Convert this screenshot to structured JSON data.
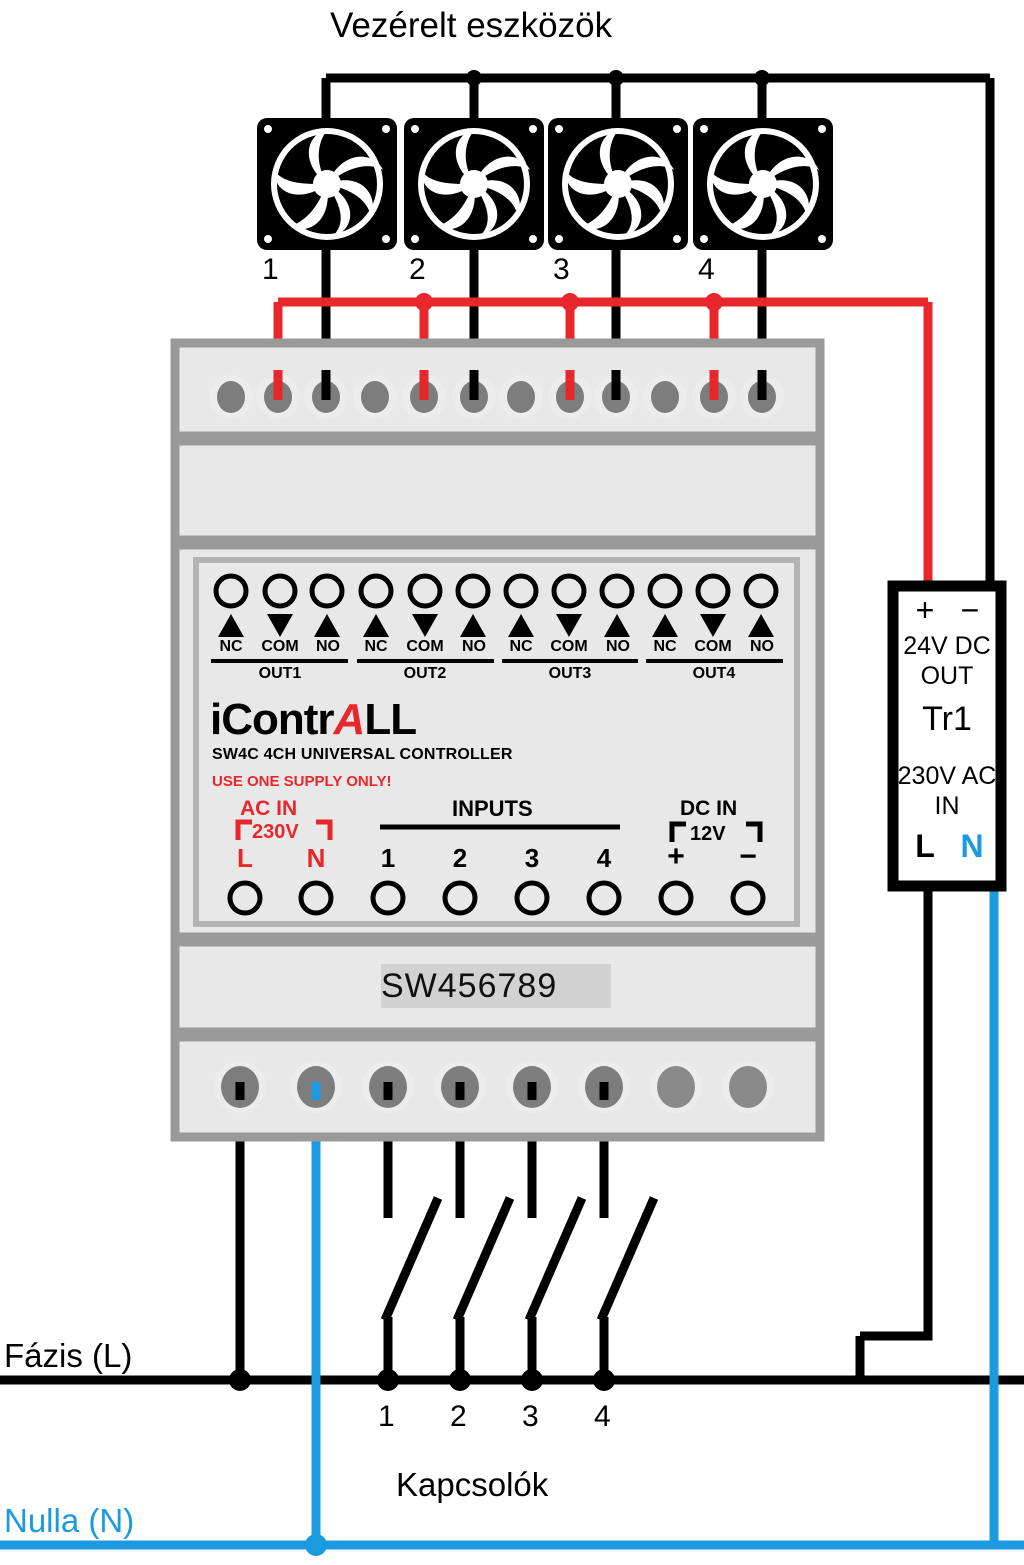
{
  "diagram": {
    "title_top": "Vezérelt eszközök",
    "label_phase": "Fázis (L)",
    "label_neutral": "Nulla (N)",
    "label_switches": "Kapcsolók",
    "colors": {
      "wire_live": "#000000",
      "wire_neutral": "#1b9ae0",
      "wire_relay": "#e8272c",
      "device_body": "#e8e8e8",
      "device_border": "#9a9a9a",
      "accent_red": "#e8272c"
    }
  },
  "loads": {
    "icon": "fan-icon",
    "numbers": [
      "1",
      "2",
      "3",
      "4"
    ]
  },
  "switches": {
    "numbers": [
      "1",
      "2",
      "3",
      "4"
    ]
  },
  "device": {
    "brand_prefix": "iContr",
    "brand_flash": "A",
    "brand_suffix": "LL",
    "model": "SW4C 4CH UNIVERSAL CONTROLLER",
    "warning": "USE ONE SUPPLY ONLY!",
    "serial": "SW456789",
    "ac_in_title": "AC IN",
    "ac_in_volt": "230V",
    "dc_in_title": "DC IN",
    "dc_in_volt": "12V",
    "inputs_title": "INPUTS",
    "outputs": [
      {
        "name": "OUT1",
        "terminals": [
          "NC",
          "COM",
          "NO"
        ]
      },
      {
        "name": "OUT2",
        "terminals": [
          "NC",
          "COM",
          "NO"
        ]
      },
      {
        "name": "OUT3",
        "terminals": [
          "NC",
          "COM",
          "NO"
        ]
      },
      {
        "name": "OUT4",
        "terminals": [
          "NC",
          "COM",
          "NO"
        ]
      }
    ],
    "bottom_pins": [
      "L",
      "N",
      "1",
      "2",
      "3",
      "4",
      "+",
      "−"
    ]
  },
  "transformer": {
    "out_plus": "+",
    "out_minus": "−",
    "out_spec": "24V DC",
    "out_word": "OUT",
    "name": "Tr1",
    "in_spec": "230V AC",
    "in_word": "IN",
    "in_L": "L",
    "in_N": "N"
  }
}
